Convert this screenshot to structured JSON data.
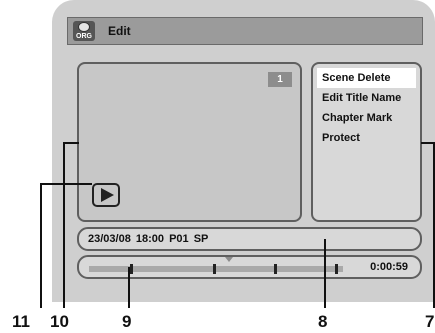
{
  "window": {
    "title": "Edit",
    "icon_label": "ORG",
    "icon": "org-disc-icon"
  },
  "preview": {
    "title_number": "1",
    "play_icon": "play-icon"
  },
  "menu": {
    "items": [
      {
        "label": "Scene Delete",
        "selected": true
      },
      {
        "label": "Edit Title Name",
        "selected": false
      },
      {
        "label": "Chapter Mark",
        "selected": false
      },
      {
        "label": "Protect",
        "selected": false
      }
    ]
  },
  "info": {
    "text": "23/03/08 18:00  P01  SP"
  },
  "progress": {
    "elapsed": "0:00:59",
    "position_fraction": 0.55,
    "chapter_mark_fractions": [
      0.16,
      0.49,
      0.73
    ]
  },
  "callouts": [
    "11",
    "10",
    "9",
    "8",
    "7"
  ],
  "colors": {
    "screen_bg": "#cfcfcf",
    "titlebar_bg": "#9b9b9b",
    "panel_bg": "#d8d8d8",
    "selected_bg": "#ffffff",
    "border": "#5f5f5f"
  }
}
